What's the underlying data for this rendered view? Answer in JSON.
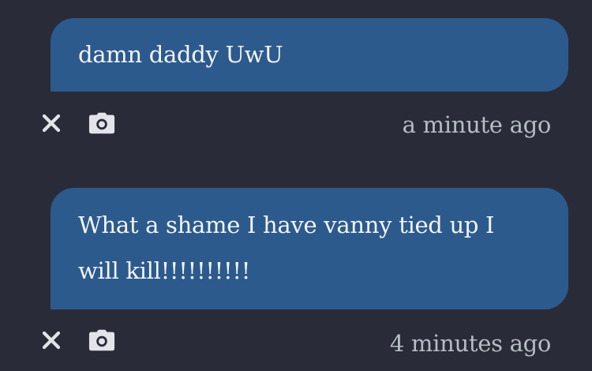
{
  "messages": [
    {
      "text": "damn daddy UwU",
      "timestamp": "a minute ago",
      "delete_icon": "close-icon",
      "screenshot_icon": "camera-icon"
    },
    {
      "text": "What a shame I have vanny tied up I will kill!!!!!!!!!!",
      "timestamp": "4 minutes ago",
      "delete_icon": "close-icon",
      "screenshot_icon": "camera-icon"
    }
  ],
  "colors": {
    "background": "#292c38",
    "bubble": "#2c5a8c",
    "bubble_text": "#f2f4f8",
    "meta_text": "#b8bcc6",
    "icon": "#e2e4ea"
  }
}
